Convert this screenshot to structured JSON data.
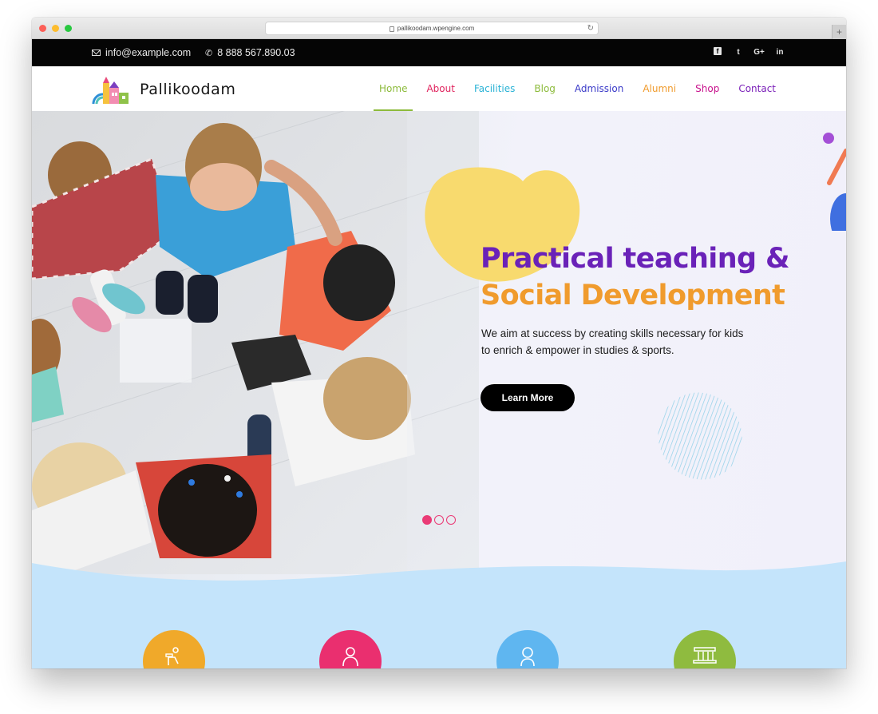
{
  "browser": {
    "url": "pallikoodam.wpengine.com"
  },
  "topbar": {
    "email": "info@example.com",
    "phone": "8 888 567.890.03",
    "socials": [
      {
        "icon": "facebook-icon",
        "glyph": "f"
      },
      {
        "icon": "twitter-icon",
        "glyph": "t"
      },
      {
        "icon": "google-plus-icon",
        "glyph": "G+"
      },
      {
        "icon": "linkedin-icon",
        "glyph": "in"
      }
    ]
  },
  "header": {
    "logo_text": "Pallikoodam",
    "nav": [
      {
        "label": "Home",
        "color": "#8dbb3c",
        "active": true
      },
      {
        "label": "About",
        "color": "#e0245e"
      },
      {
        "label": "Facilities",
        "color": "#2bb3d6"
      },
      {
        "label": "Blog",
        "color": "#8dbb3c"
      },
      {
        "label": "Admission",
        "color": "#3a3ac8"
      },
      {
        "label": "Alumni",
        "color": "#f09b2d"
      },
      {
        "label": "Shop",
        "color": "#c8118c"
      },
      {
        "label": "Contact",
        "color": "#7a1fb8"
      }
    ]
  },
  "hero": {
    "title_line1": "Practical teaching &",
    "title_line2": "Social Development",
    "subtitle": "We aim at success by creating skills necessary for kids to enrich & empower in studies & sports.",
    "cta_label": "Learn More",
    "slides": 3,
    "active_slide": 1
  },
  "features": [
    {
      "icon": "reading-icon",
      "color": "#f0a92a"
    },
    {
      "icon": "teacher-icon",
      "color": "#ea2f6f"
    },
    {
      "icon": "student-icon",
      "color": "#5fb6f0"
    },
    {
      "icon": "building-icon",
      "color": "#8fbb3f"
    }
  ],
  "colors": {
    "accent_purple": "#6a22b8",
    "accent_orange": "#f09b2d",
    "wave_blue": "#c4e4fb"
  }
}
